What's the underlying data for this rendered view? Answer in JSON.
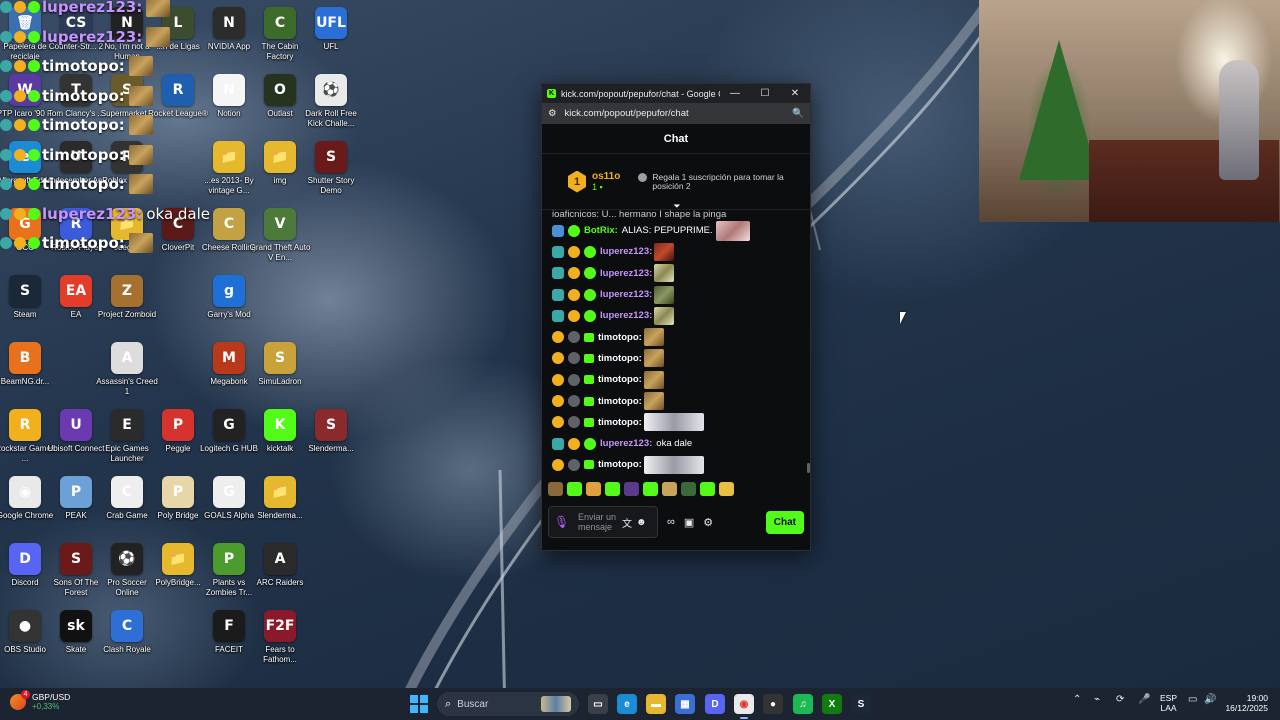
{
  "desktop_icons": [
    {
      "label": "Papelera de reciclaje",
      "color": "#3a6fb0",
      "glyph": "🗑",
      "col": 0,
      "row": 0
    },
    {
      "label": "Counter-Str... 2",
      "color": "#2b3a55",
      "glyph": "CS",
      "col": 1,
      "row": 0
    },
    {
      "label": "No, I'm not a Human",
      "color": "#222",
      "glyph": "N",
      "col": 2,
      "row": 0
    },
    {
      "label": "...h de Ligas",
      "color": "#3b4d2e",
      "glyph": "L",
      "col": 3,
      "row": 0
    },
    {
      "label": "NVIDIA App",
      "color": "#2c2c2c",
      "glyph": "N",
      "col": 4,
      "row": 0
    },
    {
      "label": "The Cabin Factory",
      "color": "#3d6b2b",
      "glyph": "C",
      "col": 5,
      "row": 0
    },
    {
      "label": "UFL",
      "color": "#2a6fd6",
      "glyph": "UFL",
      "col": 6,
      "row": 0
    },
    {
      "label": "PTP Icaro '90 F.",
      "color": "#5a3aa0",
      "glyph": "W",
      "col": 0,
      "row": 1
    },
    {
      "label": "Tom Clancy's ...",
      "color": "#333",
      "glyph": "T",
      "col": 1,
      "row": 1
    },
    {
      "label": "Supermarket...",
      "color": "#6b5a2a",
      "glyph": "S",
      "col": 2,
      "row": 1
    },
    {
      "label": "Rocket League®",
      "color": "#1e5fb0",
      "glyph": "R",
      "col": 3,
      "row": 1
    },
    {
      "label": "Notion",
      "color": "#f5f5f5",
      "glyph": "N",
      "col": 4,
      "row": 1
    },
    {
      "label": "Outlast",
      "color": "#26331f",
      "glyph": "O",
      "col": 5,
      "row": 1
    },
    {
      "label": "Dark Roll Free Kick Challe...",
      "color": "#eaeaea",
      "glyph": "⚽",
      "col": 6,
      "row": 1
    },
    {
      "label": "Microsoft Edge",
      "color": "#1c8bd6",
      "glyph": "e",
      "col": 0,
      "row": 2
    },
    {
      "label": "Undecember App",
      "color": "#2b2b2b",
      "glyph": "U",
      "col": 1,
      "row": 2
    },
    {
      "label": "Roblox Studio",
      "color": "#333",
      "glyph": "R",
      "col": 2,
      "row": 2
    },
    {
      "label": "...es 2013- By vintage G...",
      "color": "#e6b82e",
      "glyph": "📁",
      "col": 4,
      "row": 2
    },
    {
      "label": "img",
      "color": "#e6b82e",
      "glyph": "📁",
      "col": 5,
      "row": 2
    },
    {
      "label": "Shutter Story Demo",
      "color": "#6b1a1a",
      "glyph": "S",
      "col": 6,
      "row": 2
    },
    {
      "label": "GCC",
      "color": "#e8711e",
      "glyph": "G",
      "col": 0,
      "row": 3
    },
    {
      "label": "Roblox Player",
      "color": "#3b5bdb",
      "glyph": "R",
      "col": 1,
      "row": 3
    },
    {
      "label": "Juegos",
      "color": "#e6b82e",
      "glyph": "📁",
      "col": 2,
      "row": 3
    },
    {
      "label": "CloverPit",
      "color": "#5a1a1a",
      "glyph": "C",
      "col": 3,
      "row": 3
    },
    {
      "label": "Cheese Rolling",
      "color": "#c2a243",
      "glyph": "C",
      "col": 4,
      "row": 3
    },
    {
      "label": "Grand Theft Auto V En...",
      "color": "#4d7a3a",
      "glyph": "V",
      "col": 5,
      "row": 3
    },
    {
      "label": "Steam",
      "color": "#1b2838",
      "glyph": "S",
      "col": 0,
      "row": 4
    },
    {
      "label": "EA",
      "color": "#e23d28",
      "glyph": "EA",
      "col": 1,
      "row": 4
    },
    {
      "label": "Project Zomboid",
      "color": "#a6702e",
      "glyph": "Z",
      "col": 2,
      "row": 4
    },
    {
      "label": "Garry's Mod",
      "color": "#1e6fd6",
      "glyph": "g",
      "col": 4,
      "row": 4
    },
    {
      "label": "BeamNG.dr...",
      "color": "#e8711e",
      "glyph": "B",
      "col": 0,
      "row": 5
    },
    {
      "label": "Assassin's Creed 1",
      "color": "#ddd",
      "glyph": "A",
      "col": 2,
      "row": 5
    },
    {
      "label": "Megabonk",
      "color": "#b83a1a",
      "glyph": "M",
      "col": 4,
      "row": 5
    },
    {
      "label": "SimuLadron",
      "color": "#c9a33a",
      "glyph": "S",
      "col": 5,
      "row": 5
    },
    {
      "label": "Rockstar Games ...",
      "color": "#f2b01e",
      "glyph": "R",
      "col": 0,
      "row": 6
    },
    {
      "label": "Ubisoft Connect",
      "color": "#6b3ab0",
      "glyph": "U",
      "col": 1,
      "row": 6
    },
    {
      "label": "Epic Games Launcher",
      "color": "#2b2b2b",
      "glyph": "E",
      "col": 2,
      "row": 6
    },
    {
      "label": "Peggle",
      "color": "#d6332e",
      "glyph": "P",
      "col": 3,
      "row": 6
    },
    {
      "label": "Logitech G HUB",
      "color": "#222",
      "glyph": "G",
      "col": 4,
      "row": 6
    },
    {
      "label": "kicktalk",
      "color": "#53fc18",
      "glyph": "K",
      "col": 5,
      "row": 6
    },
    {
      "label": "Slenderma...",
      "color": "#8a2a2a",
      "glyph": "S",
      "col": 6,
      "row": 6
    },
    {
      "label": "Google Chrome",
      "color": "#e9e9e9",
      "glyph": "◉",
      "col": 0,
      "row": 7
    },
    {
      "label": "PEAK",
      "color": "#6da0d6",
      "glyph": "P",
      "col": 1,
      "row": 7
    },
    {
      "label": "Crab Game",
      "color": "#eee",
      "glyph": "C",
      "col": 2,
      "row": 7
    },
    {
      "label": "Poly Bridge",
      "color": "#e6d6a8",
      "glyph": "P",
      "col": 3,
      "row": 7
    },
    {
      "label": "GOALS Alpha",
      "color": "#eee",
      "glyph": "G",
      "col": 4,
      "row": 7
    },
    {
      "label": "Slenderma...",
      "color": "#e6b82e",
      "glyph": "📁",
      "col": 5,
      "row": 7
    },
    {
      "label": "Discord",
      "color": "#5865f2",
      "glyph": "D",
      "col": 0,
      "row": 8
    },
    {
      "label": "Sons Of The Forest",
      "color": "#6b1a1a",
      "glyph": "S",
      "col": 1,
      "row": 8
    },
    {
      "label": "Pro Soccer Online",
      "color": "#222",
      "glyph": "⚽",
      "col": 2,
      "row": 8
    },
    {
      "label": "PolyBridge...",
      "color": "#e6b82e",
      "glyph": "📁",
      "col": 3,
      "row": 8
    },
    {
      "label": "Plants vs Zombies Tr...",
      "color": "#4d9a2e",
      "glyph": "P",
      "col": 4,
      "row": 8
    },
    {
      "label": "ARC Raiders",
      "color": "#2a2a2a",
      "glyph": "A",
      "col": 5,
      "row": 8
    },
    {
      "label": "OBS Studio",
      "color": "#333",
      "glyph": "●",
      "col": 0,
      "row": 9
    },
    {
      "label": "Skate",
      "color": "#111",
      "glyph": "sk",
      "col": 1,
      "row": 9
    },
    {
      "label": "Clash Royale",
      "color": "#2e6fd6",
      "glyph": "C",
      "col": 2,
      "row": 9
    },
    {
      "label": "FACEIT",
      "color": "#1b1b1b",
      "glyph": "F",
      "col": 4,
      "row": 9
    },
    {
      "label": "Fears to Fathom...",
      "color": "#8a1a2a",
      "glyph": "F2F",
      "col": 5,
      "row": 9
    }
  ],
  "overlay_chat": [
    {
      "name": "luperez123:",
      "color": "#c794ff",
      "message": ""
    },
    {
      "name": "luperez123:",
      "color": "#c794ff",
      "message": ""
    },
    {
      "name": "timotopo:",
      "color": "#ffffff",
      "message": ""
    },
    {
      "name": "timotopo:",
      "color": "#ffffff",
      "message": ""
    },
    {
      "name": "timotopo:",
      "color": "#ffffff",
      "message": ""
    },
    {
      "name": "timotopo:",
      "color": "#ffffff",
      "message": ""
    },
    {
      "name": "timotopo:",
      "color": "#ffffff",
      "message": ""
    },
    {
      "name": "luperez123:",
      "color": "#c794ff",
      "message": "oka dale"
    },
    {
      "name": "timotopo:",
      "color": "#ffffff",
      "message": ""
    }
  ],
  "browser": {
    "title": "kick.com/popout/pepufor/chat - Google Ch...",
    "url": "kick.com/popout/pepufor/chat",
    "minimize": "—",
    "maximize": "☐",
    "close": "✕"
  },
  "chat": {
    "header": "Chat",
    "pinned": {
      "badge": "1",
      "gifter": "os11o",
      "gift_count": "1",
      "info": "Regala 1 suscripción para tomar la posición 2"
    },
    "truncated_top": "ioaficnicos: U... hermano I shape la pinga",
    "messages": [
      {
        "badges": [
          "bot",
          "ver"
        ],
        "user": "BotRix:",
        "user_color": "green",
        "text": "ALIAS: PEPUPRIME.",
        "emote": "face"
      },
      {
        "badges": [
          "grid",
          "sub",
          "ver"
        ],
        "user": "luperez123:",
        "user_color": "purple",
        "text": "",
        "emote": "red"
      },
      {
        "badges": [
          "grid",
          "sub",
          "ver"
        ],
        "user": "luperez123:",
        "user_color": "purple",
        "text": "",
        "emote": "pale"
      },
      {
        "badges": [
          "grid",
          "sub",
          "ver"
        ],
        "user": "luperez123:",
        "user_color": "purple",
        "text": "",
        "emote": "moss"
      },
      {
        "badges": [
          "grid",
          "sub",
          "ver"
        ],
        "user": "luperez123:",
        "user_color": "purple",
        "text": "",
        "emote": "pale"
      },
      {
        "badges": [
          "sub",
          "gray",
          "gift"
        ],
        "user": "timotopo:",
        "user_color": "white",
        "text": "",
        "emote": "gold"
      },
      {
        "badges": [
          "sub",
          "gray",
          "gift"
        ],
        "user": "timotopo:",
        "user_color": "white",
        "text": "",
        "emote": "gold"
      },
      {
        "badges": [
          "sub",
          "gray",
          "gift"
        ],
        "user": "timotopo:",
        "user_color": "white",
        "text": "",
        "emote": "gold"
      },
      {
        "badges": [
          "sub",
          "gray",
          "gift"
        ],
        "user": "timotopo:",
        "user_color": "white",
        "text": "",
        "emote": "gold"
      },
      {
        "badges": [
          "sub",
          "gray",
          "gift"
        ],
        "user": "timotopo:",
        "user_color": "white",
        "text": "",
        "emote": "wide"
      },
      {
        "badges": [
          "grid",
          "sub",
          "ver"
        ],
        "user": "luperez123:",
        "user_color": "purple",
        "text": "oka dale",
        "emote": ""
      },
      {
        "badges": [
          "sub",
          "gray",
          "gift"
        ],
        "user": "timotopo:",
        "user_color": "white",
        "text": "",
        "emote": "wide"
      }
    ],
    "emote_bar_colors": [
      "#8a6a3a",
      "#53fc18",
      "#e0a040",
      "#53fc18",
      "#5a3a8a",
      "#53fc18",
      "#c9a35c",
      "#3a6a3a",
      "#53fc18",
      "#e8c040"
    ],
    "composer": {
      "placeholder": "Enviar un mensaje",
      "send_label": "Chat"
    }
  },
  "taskbar": {
    "widget_title": "GBP/USD",
    "widget_change": "+0,33%",
    "widget_badge": "4",
    "search_placeholder": "Buscar",
    "lang_line1": "ESP",
    "lang_line2": "LAA",
    "time": "19:00",
    "date": "16/12/2025"
  }
}
